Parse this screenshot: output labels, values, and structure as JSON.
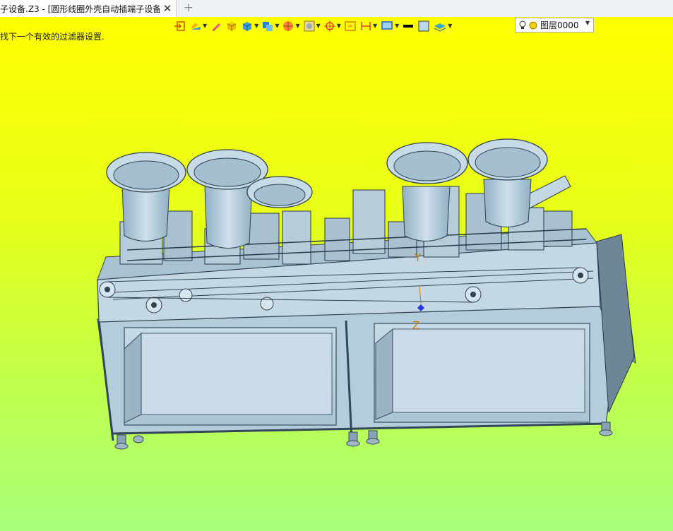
{
  "tab": {
    "title": "子设备.Z3 - [圆形线圈外壳自动插端子设备]",
    "close_icon": "close-icon",
    "add_icon": "plus-icon"
  },
  "viewport": {
    "status_message": "找下一个有效的过滤器设置.",
    "background_top": "#ffff00",
    "background_bottom": "#a6ff7a",
    "model_color": "#b9d2e0",
    "axes": {
      "y_label": "Y",
      "z_label": "Z"
    }
  },
  "toolbar": {
    "icons": [
      "exit-sketch-icon",
      "construction-icon",
      "pen-icon",
      "box-icon",
      "extrude-icon",
      "shaded-view-icon",
      "sphere-icon",
      "filter-icon",
      "target-icon",
      "frame-icon",
      "dimension-icon",
      "display-icon",
      "line-color-icon",
      "fill-color-icon",
      "layer-style-icon"
    ],
    "layer": {
      "value": "图层0000"
    }
  }
}
